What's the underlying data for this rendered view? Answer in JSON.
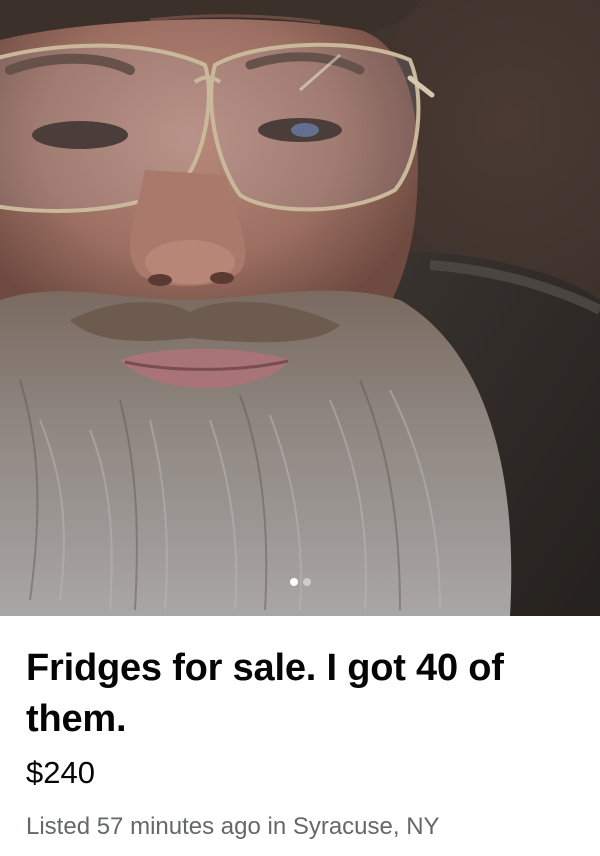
{
  "listing": {
    "title": "Fridges for sale. I got 40 of them.",
    "price": "$240",
    "meta": "Listed 57 minutes ago in Syracuse, NY"
  },
  "carousel": {
    "image_count": 2,
    "active_index": 0
  },
  "colors": {
    "title_text": "#050505",
    "meta_text": "#65676b",
    "background": "#ffffff",
    "dot_active": "#ffffff"
  }
}
